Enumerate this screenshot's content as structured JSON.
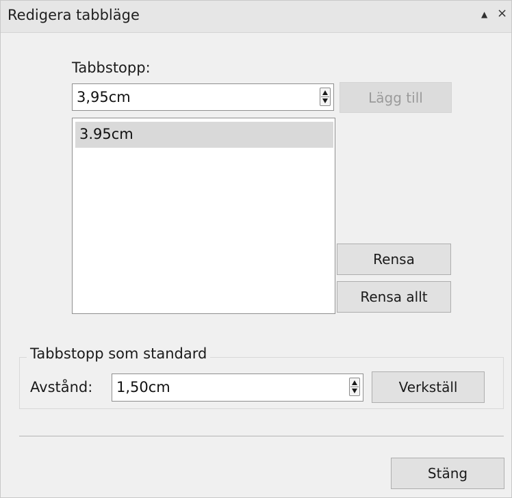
{
  "window": {
    "title": "Redigera tabbläge",
    "collapse_glyph": "▲",
    "close_glyph": "×"
  },
  "tab_stops": {
    "label": "Tabbstopp:",
    "value": "3,95cm",
    "add_label": "Lägg till",
    "items": [
      "3.95cm"
    ],
    "clear_label": "Rensa",
    "clear_all_label": "Rensa allt"
  },
  "default_tab_stops": {
    "group_title": "Tabbstopp som standard",
    "spacing_label": "Avstånd:",
    "spacing_value": "1,50cm",
    "apply_label": "Verkställ"
  },
  "footer": {
    "close_label": "Stäng"
  },
  "icons": {
    "collapse": "collapse-icon",
    "close": "close-icon",
    "spin": "spinner-arrows-icon"
  }
}
